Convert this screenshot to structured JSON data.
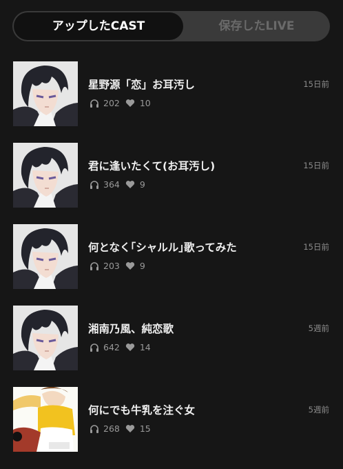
{
  "tabs": {
    "active_label": "アップしたCAST",
    "inactive_label": "保存したLIVE"
  },
  "items": [
    {
      "title": "星野源「恋」お耳汚し",
      "plays": "202",
      "likes": "10",
      "ago": "15日前",
      "thumbnail": "anime-character"
    },
    {
      "title": "君に逢いたくて(お耳汚し)",
      "plays": "364",
      "likes": "9",
      "ago": "15日前",
      "thumbnail": "anime-character"
    },
    {
      "title": "何となく｢シャルル｣歌ってみた",
      "plays": "203",
      "likes": "9",
      "ago": "15日前",
      "thumbnail": "anime-character"
    },
    {
      "title": "湘南乃風、純恋歌",
      "plays": "642",
      "likes": "14",
      "ago": "5週前",
      "thumbnail": "anime-character"
    },
    {
      "title": "何にでも牛乳を注ぐ女",
      "plays": "268",
      "likes": "15",
      "ago": "5週前",
      "thumbnail": "cartoon-woman-yellow"
    }
  ],
  "colors": {
    "background": "#161616",
    "segment_bg": "#3a3a3a",
    "segment_active": "#111111",
    "text_primary": "#efefef",
    "text_secondary": "#9a9a9a"
  },
  "icons": {
    "plays": "headphones-icon",
    "likes": "heart-icon"
  }
}
